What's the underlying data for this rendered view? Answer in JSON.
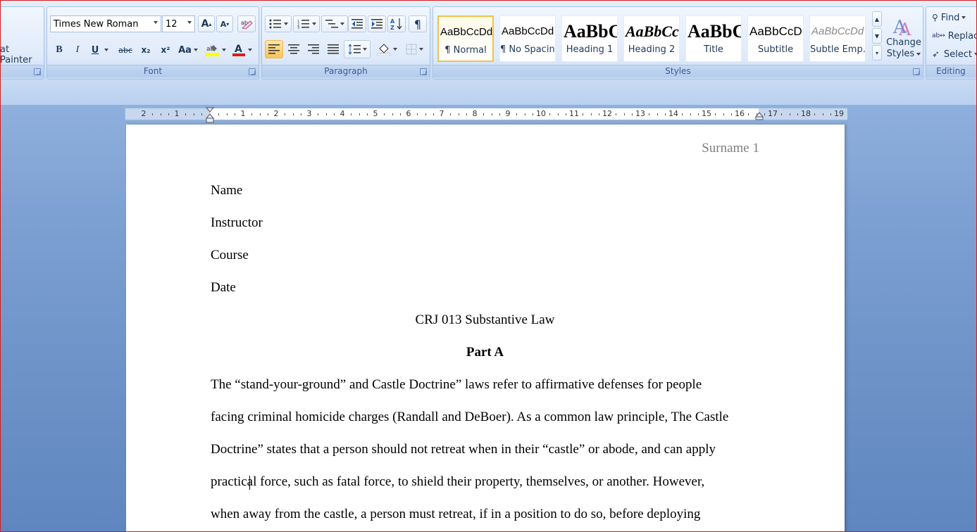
{
  "ribbon": {
    "clipboard": {
      "format_painter": "at Painter"
    },
    "font": {
      "label": "Font",
      "font_name": "Times New Roman",
      "font_size": "12",
      "grow": "A",
      "shrink": "A",
      "bold": "B",
      "italic": "I",
      "underline": "U",
      "strike": "abc",
      "subscript": "x₂",
      "superscript": "x²",
      "change_case": "Aa",
      "highlight_color": "#ffff00",
      "font_color": "#e01b1b"
    },
    "paragraph": {
      "label": "Paragraph"
    },
    "styles": {
      "label": "Styles",
      "items": [
        {
          "preview": "AaBbCcDd",
          "name": "¶ Normal"
        },
        {
          "preview": "AaBbCcDd",
          "name": "¶ No Spacing"
        },
        {
          "preview": "AaBbC",
          "name": "Heading 1"
        },
        {
          "preview": "AaBbCc",
          "name": "Heading 2"
        },
        {
          "preview": "AaBbC",
          "name": "Title"
        },
        {
          "preview": "AaBbCcD",
          "name": "Subtitle"
        },
        {
          "preview": "AaBbCcDd",
          "name": "Subtle Emp..."
        }
      ],
      "change_styles_line1": "Change",
      "change_styles_line2": "Styles"
    },
    "editing": {
      "label": "Editing",
      "find": "Find",
      "replace": "Replace",
      "select": "Select"
    }
  },
  "ruler": {
    "left_numbers": [
      "2",
      "1"
    ],
    "right_numbers": [
      "1",
      "2",
      "3",
      "4",
      "5",
      "6",
      "7",
      "8",
      "9",
      "10",
      "11",
      "12",
      "13",
      "14",
      "15",
      "16",
      "17",
      "18",
      "19"
    ]
  },
  "document": {
    "header": "Surname 1",
    "name": "Name",
    "instructor": "Instructor",
    "course": "Course",
    "date": "Date",
    "title": "CRJ 013 Substantive Law",
    "subtitle": "Part A",
    "body_lines": [
      "The “stand-your-ground” and Castle Doctrine” laws refer to affirmative defenses for people",
      "facing criminal homicide charges (Randall and DeBoer). As a common law principle, The Castle",
      "Doctrine” states that a person should not retreat when in their “castle” or abode, and can apply",
      "practical force, such as fatal force, to shield their property, themselves, or another. However,",
      "when away from the castle, a person must retreat, if in a position to do so, before deploying"
    ]
  }
}
